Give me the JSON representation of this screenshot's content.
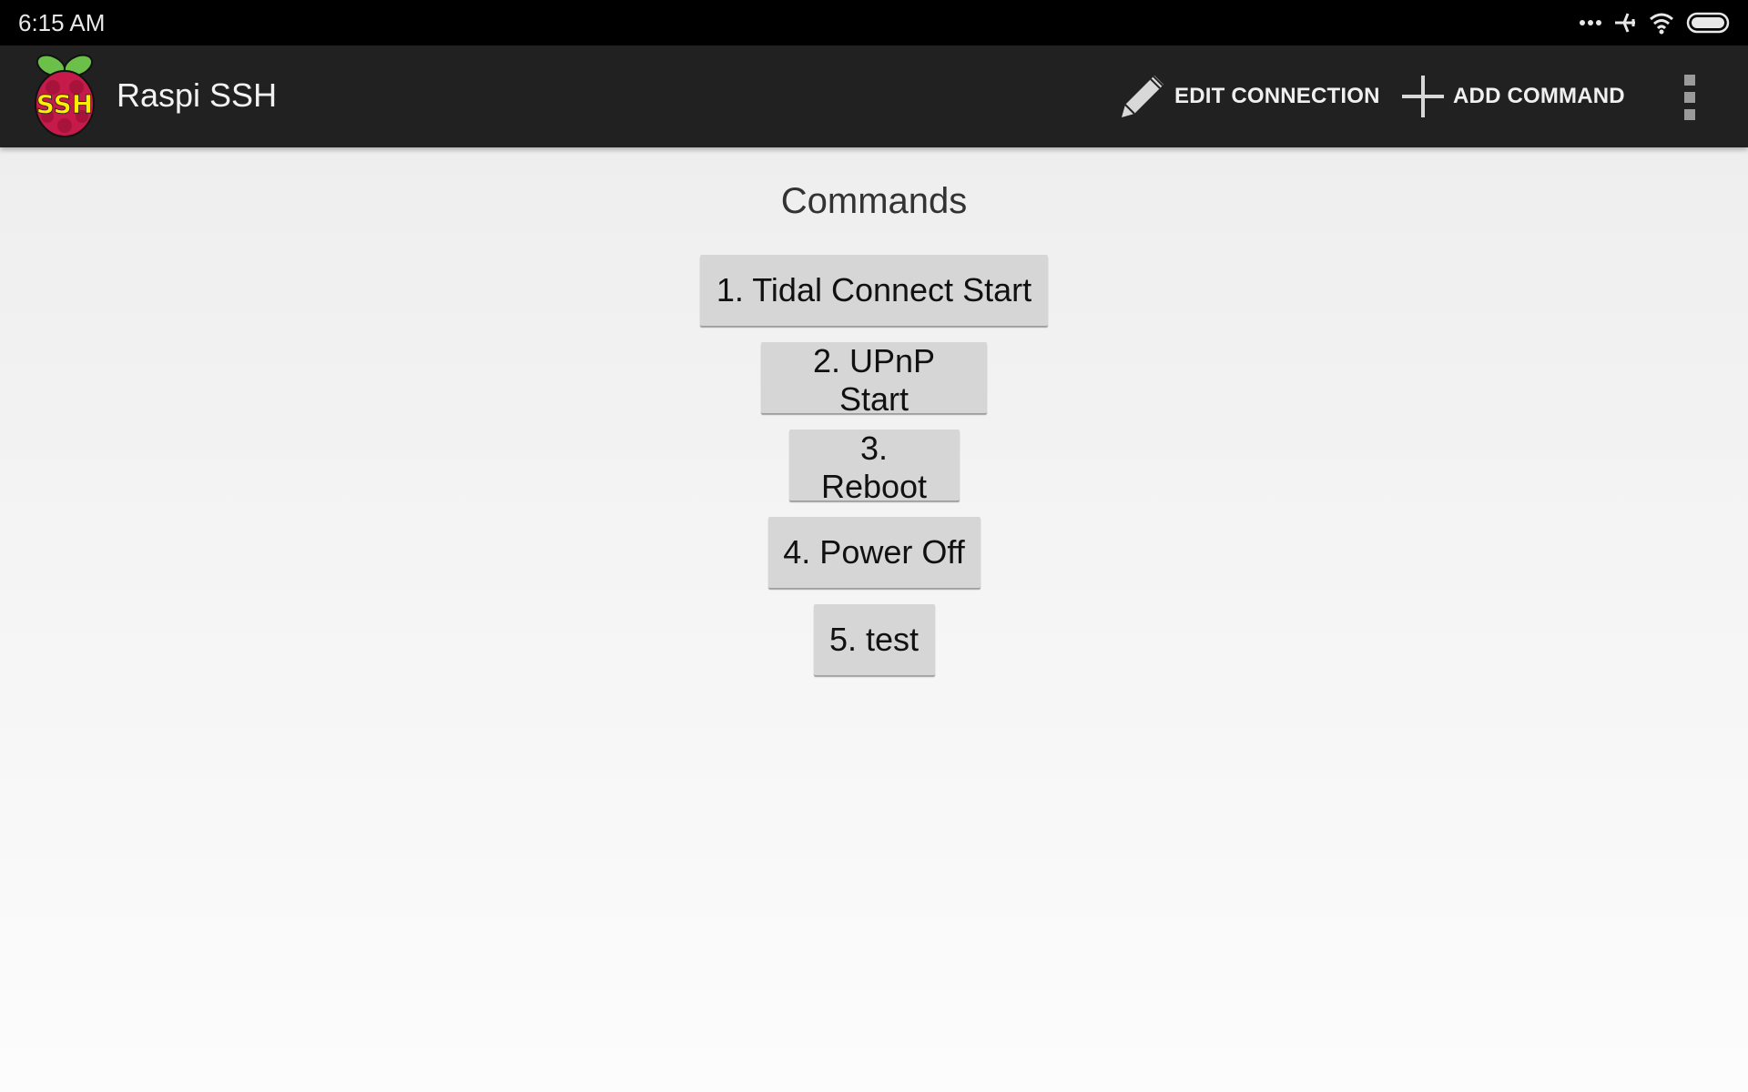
{
  "status_bar": {
    "time": "6:15  AM",
    "icons": [
      "more-notifications-icon",
      "airplane-mode-icon",
      "wifi-icon",
      "battery-icon"
    ]
  },
  "app_bar": {
    "title": "Raspi SSH",
    "logo_text": "SSH",
    "actions": [
      {
        "label": "EDIT CONNECTION",
        "icon": "pencil-icon"
      },
      {
        "label": "ADD COMMAND",
        "icon": "plus-icon"
      }
    ],
    "overflow_icon": "overflow-menu-icon"
  },
  "main": {
    "title": "Commands",
    "commands": [
      {
        "label": "1. Tidal Connect Start"
      },
      {
        "label": "2. UPnP Start"
      },
      {
        "label": "3. Reboot"
      },
      {
        "label": "4. Power Off"
      },
      {
        "label": "5. test"
      }
    ]
  },
  "colors": {
    "app_bar": "#212121",
    "status_bar": "#000000",
    "button": "#d6d6d6",
    "logo_berry": "#c51a4a",
    "logo_leaf": "#6cc04a",
    "logo_text": "#ffee00"
  }
}
